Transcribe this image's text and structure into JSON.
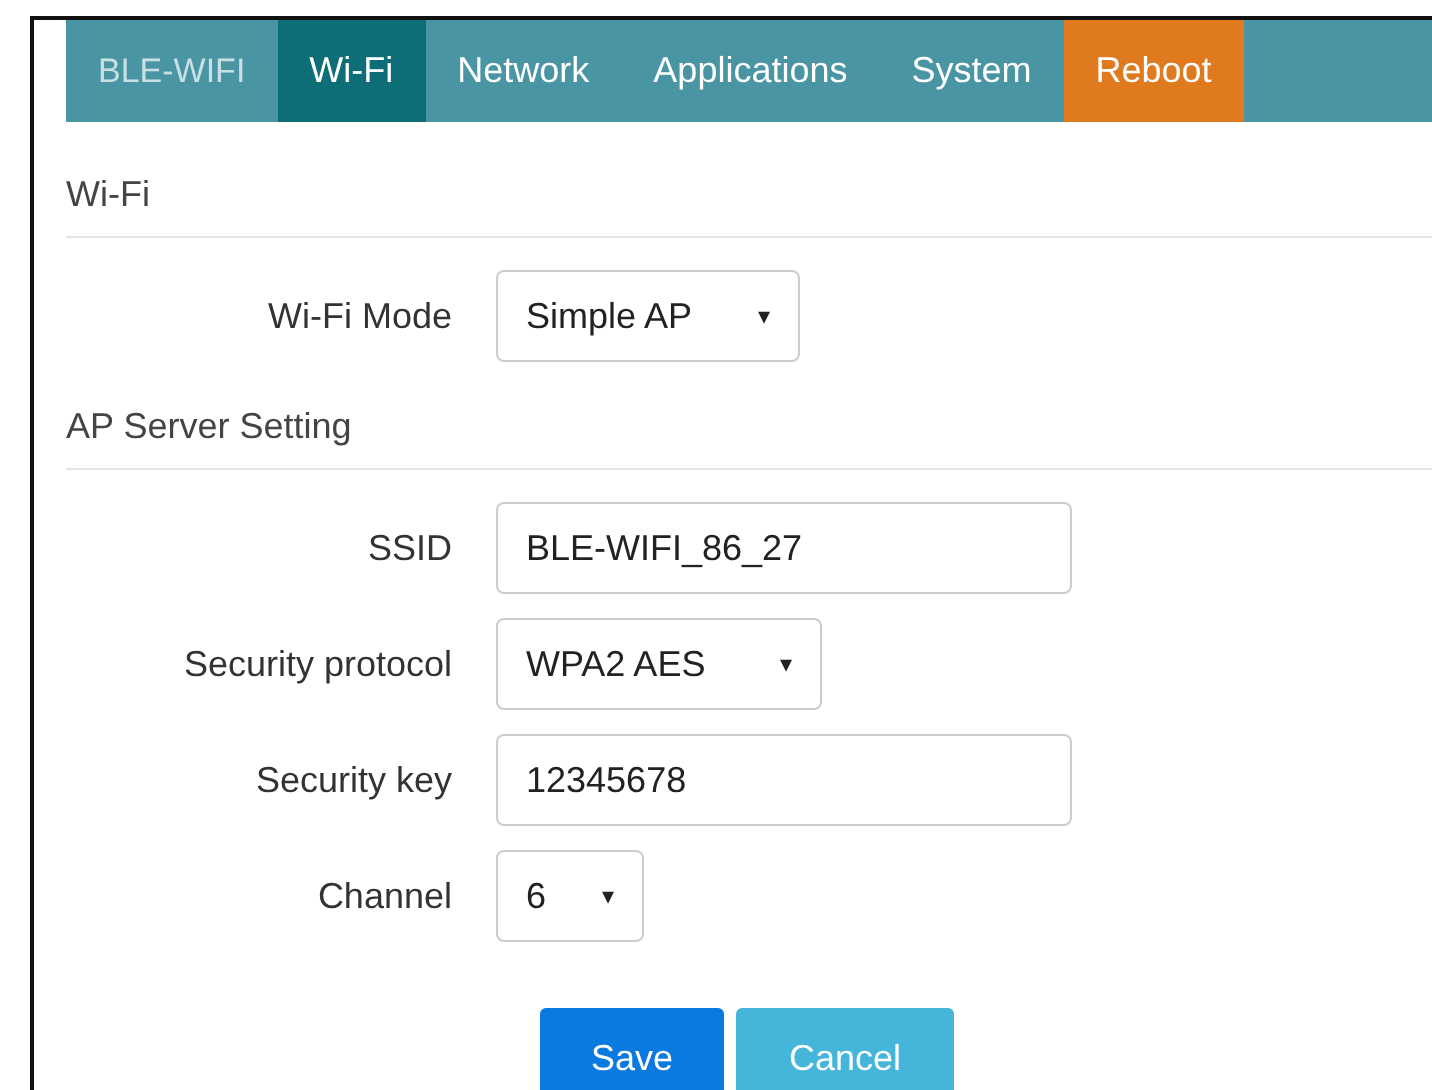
{
  "nav": [
    {
      "label": "BLE-WIFI",
      "kind": "brand",
      "selected": false
    },
    {
      "label": "Wi-Fi",
      "kind": "tab",
      "selected": true
    },
    {
      "label": "Network",
      "kind": "tab",
      "selected": false
    },
    {
      "label": "Applications",
      "kind": "tab",
      "selected": false
    },
    {
      "label": "System",
      "kind": "tab",
      "selected": false
    },
    {
      "label": "Reboot",
      "kind": "reboot",
      "selected": false
    }
  ],
  "sections": [
    {
      "title": "Wi-Fi",
      "fields": [
        {
          "label": "Wi-Fi Mode",
          "kind": "select",
          "value": "Simple AP",
          "caret": "▾"
        }
      ]
    },
    {
      "title": "AP Server Setting",
      "fields": [
        {
          "label": "SSID",
          "kind": "text",
          "value": "BLE-WIFI_86_27"
        },
        {
          "label": "Security protocol",
          "kind": "select",
          "value": "WPA2 AES",
          "caret": "▾"
        },
        {
          "label": "Security key",
          "kind": "text",
          "value": "12345678"
        },
        {
          "label": "Channel",
          "kind": "select",
          "value": "6",
          "caret": "▾"
        }
      ]
    }
  ],
  "buttons": [
    {
      "label": "Save",
      "kind": "primary"
    },
    {
      "label": "Cancel",
      "kind": "secondary"
    }
  ]
}
